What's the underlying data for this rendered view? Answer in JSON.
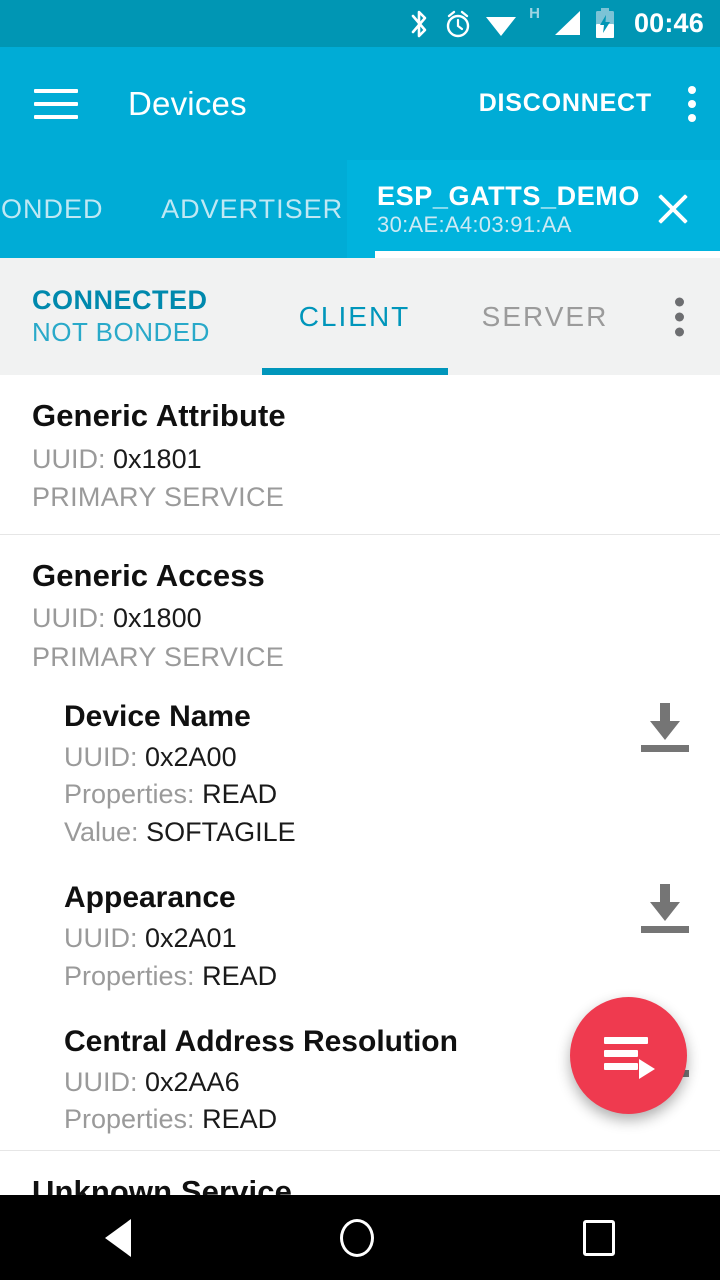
{
  "statusbar": {
    "network_label": "H",
    "clock": "00:46",
    "icons": [
      "bluetooth-icon",
      "alarm-icon",
      "wifi-icon",
      "cellular-signal-icon",
      "battery-charging-icon"
    ]
  },
  "appbar": {
    "title": "Devices",
    "disconnect_label": "DISCONNECT"
  },
  "tabs": [
    {
      "label": "BONDED",
      "active": false
    },
    {
      "label": "ADVERTISER",
      "active": false
    }
  ],
  "device_tab": {
    "name": "ESP_GATTS_DEMO",
    "address": "30:AE:A4:03:91:AA",
    "active": true
  },
  "connection": {
    "state": "CONNECTED",
    "bond": "NOT BONDED"
  },
  "subtabs": [
    {
      "label": "CLIENT",
      "active": true
    },
    {
      "label": "SERVER",
      "active": false
    }
  ],
  "services": [
    {
      "name": "Generic Attribute",
      "uuid_label": "UUID:",
      "uuid_value": "0x1801",
      "type": "PRIMARY SERVICE",
      "characteristics": []
    },
    {
      "name": "Generic Access",
      "uuid_label": "UUID:",
      "uuid_value": "0x1800",
      "type": "PRIMARY SERVICE",
      "characteristics": [
        {
          "name": "Device Name",
          "uuid_label": "UUID:",
          "uuid_value": "0x2A00",
          "properties_label": "Properties:",
          "properties_value": "READ",
          "value_label": "Value:",
          "value_value": "SOFTAGILE",
          "action_icon": "download-icon"
        },
        {
          "name": "Appearance",
          "uuid_label": "UUID:",
          "uuid_value": "0x2A01",
          "properties_label": "Properties:",
          "properties_value": "READ",
          "value_label": "",
          "value_value": "",
          "action_icon": "download-icon"
        },
        {
          "name": "Central Address Resolution",
          "uuid_label": "UUID:",
          "uuid_value": "0x2AA6",
          "properties_label": "Properties:",
          "properties_value": "READ",
          "value_label": "",
          "value_value": "",
          "action_icon": "download-icon"
        }
      ]
    }
  ],
  "partial_service": {
    "name": "Unknown Service"
  },
  "fab": {
    "icon": "run-macro-icon",
    "color": "#ef3a4f"
  },
  "navbar": {
    "back": "back-icon",
    "home": "home-icon",
    "recents": "recents-icon"
  },
  "colors": {
    "statusbar": "#0096b4",
    "appbar": "#00acd6",
    "accent": "#0096bb",
    "fab": "#ef3a4f"
  }
}
